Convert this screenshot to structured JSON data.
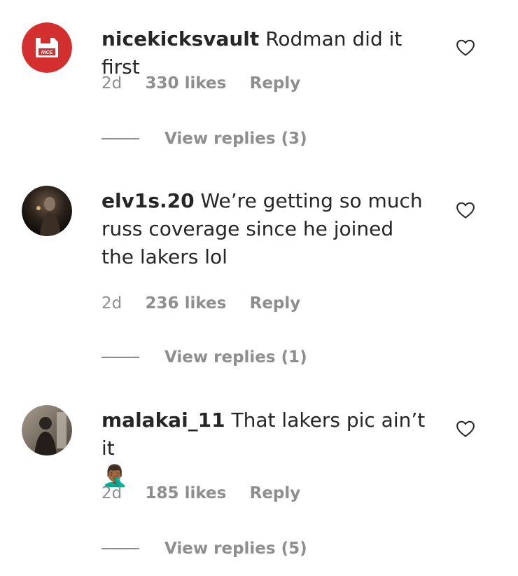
{
  "comments": [
    {
      "username": "nicekicksvault",
      "text": "Rodman did it first",
      "time": "2d",
      "likes": "330 likes",
      "reply_label": "Reply",
      "view_replies": "View replies (3)",
      "avatar_logo_text": "NICE",
      "avatar_color": "#d32f2f"
    },
    {
      "username": "elv1s.20",
      "text": "We’re getting so much russ coverage since he joined the lakers lol",
      "time": "2d",
      "likes": "236 likes",
      "reply_label": "Reply",
      "view_replies": "View replies (1)"
    },
    {
      "username": "malakai_11",
      "text": "That lakers pic ain’t it",
      "emoji": "🤦🏾‍♂️",
      "time": "2d",
      "likes": "185 likes",
      "reply_label": "Reply",
      "view_replies": "View replies (5)"
    }
  ],
  "icons": {
    "like": "heart-outline-icon"
  },
  "colors": {
    "text": "#262626",
    "muted": "#8e8e8e"
  }
}
